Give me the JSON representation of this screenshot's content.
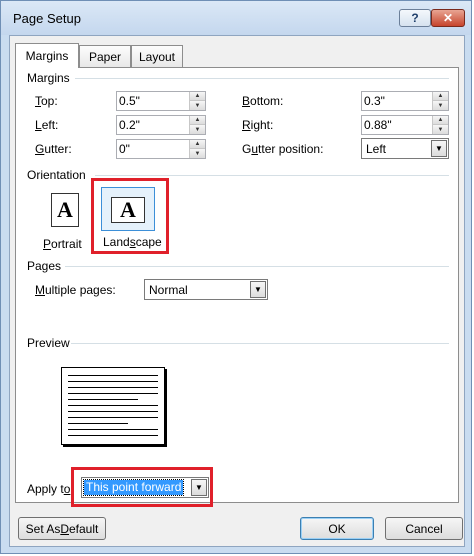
{
  "window": {
    "title": "Page Setup",
    "help_glyph": "?",
    "close_glyph": "✕"
  },
  "tabs": [
    {
      "label": "Margins",
      "active": true
    },
    {
      "label": "Paper",
      "active": false
    },
    {
      "label": "Layout",
      "active": false
    }
  ],
  "margins": {
    "group_label": "Margins",
    "top": {
      "label_key": "T",
      "label_rest": "op:",
      "value": "0.5\""
    },
    "left": {
      "label_key": "L",
      "label_rest": "eft:",
      "value": "0.2\""
    },
    "gutter": {
      "label_key": "G",
      "label_rest": "utter:",
      "value": "0\""
    },
    "bottom": {
      "label_key": "B",
      "label_rest": "ottom:",
      "value": "0.3\""
    },
    "right": {
      "label_key": "R",
      "label_rest": "ight:",
      "value": "0.88\""
    },
    "gutter_position": {
      "label_key": "u",
      "label_pre": "G",
      "label_rest": "tter position:",
      "value": "Left"
    }
  },
  "orientation": {
    "group_label": "Orientation",
    "portrait": {
      "label_key": "P",
      "label_rest": "ortrait",
      "glyph": "A"
    },
    "landscape": {
      "label_key": "s",
      "label_pre": "Land",
      "label_rest": "cape",
      "glyph": "A",
      "selected": true
    }
  },
  "pages": {
    "group_label": "Pages",
    "multiple": {
      "label_key": "M",
      "label_rest": "ultiple pages:",
      "value": "Normal"
    }
  },
  "preview": {
    "group_label": "Preview"
  },
  "apply_to": {
    "label_pre": "Apply t",
    "label_key": "o",
    "label_rest": ":",
    "value": "This point forward"
  },
  "buttons": {
    "set_default_pre": "Set As ",
    "set_default_key": "D",
    "set_default_rest": "efault",
    "ok": "OK",
    "cancel": "Cancel"
  },
  "colors": {
    "highlight_red": "#e0202a",
    "selection_blue": "#3399ff",
    "title_bar": "#c9dcf0"
  }
}
